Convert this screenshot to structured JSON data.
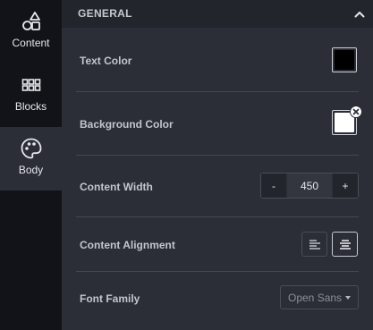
{
  "sidebar": {
    "items": [
      {
        "label": "Content",
        "icon": "shapes-icon"
      },
      {
        "label": "Blocks",
        "icon": "grid-icon"
      },
      {
        "label": "Body",
        "icon": "palette-icon"
      }
    ],
    "active": "Body"
  },
  "panel": {
    "section_title": "GENERAL",
    "text_color": {
      "label": "Text Color",
      "value": "#000000"
    },
    "background_color": {
      "label": "Background Color",
      "value": "#ffffff"
    },
    "content_width": {
      "label": "Content Width",
      "value": "450",
      "decrement": "-",
      "increment": "+"
    },
    "content_alignment": {
      "label": "Content Alignment",
      "selected": "center"
    },
    "font_family": {
      "label": "Font Family",
      "value": "Open Sans"
    }
  },
  "colors": {
    "sidebar_bg": "#111318",
    "panel_bg": "#2b2d37",
    "header_bg": "#23252d"
  }
}
